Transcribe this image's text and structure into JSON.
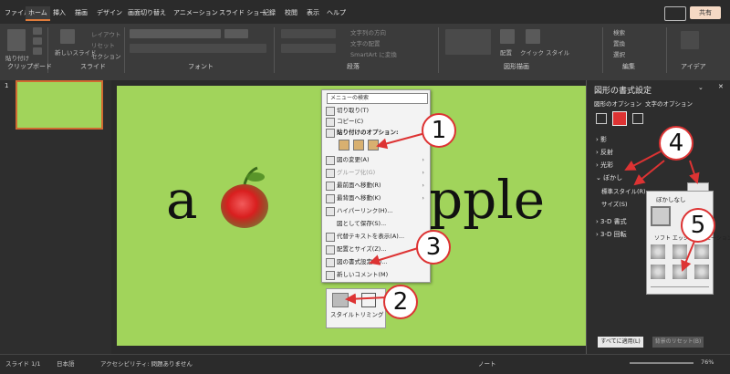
{
  "menubar": {
    "tabs": [
      "ファイル",
      "ホーム",
      "挿入",
      "描画",
      "デザイン",
      "画面切り替え",
      "アニメーション",
      "スライド ショー",
      "記録",
      "校閲",
      "表示",
      "ヘルプ"
    ],
    "share_label": "共有"
  },
  "ribbon": {
    "paste_label": "貼り付け",
    "new_slide_label": "新しいスライド",
    "layout_label": "レイアウト",
    "reset_label": "リセット",
    "section_label": "セクション",
    "text_direction_label": "文字列の方向",
    "align_text_label": "文字の配置",
    "smartart_label": "SmartArt に変換",
    "arrange_label": "配置",
    "quick_style_label": "クイック スタイル",
    "find_label": "検索",
    "replace_label": "置換",
    "select_label": "選択",
    "groups": {
      "clipboard": "クリップボード",
      "slide": "スライド",
      "font": "フォント",
      "paragraph": "段落",
      "drawing": "図形描画",
      "editing": "編集",
      "idea": "アイデア"
    }
  },
  "thumbs": {
    "number": "1"
  },
  "slide": {
    "text_left": "a",
    "text_right": "pple"
  },
  "context_menu": {
    "search": "メニューの検索",
    "items": [
      {
        "label": "切り取り(T)",
        "disabled": false,
        "arrow": ""
      },
      {
        "label": "コピー(C)",
        "disabled": false,
        "arrow": ""
      },
      {
        "label": "貼り付けのオプション:",
        "disabled": false,
        "arrow": ""
      },
      {
        "label": "図の変更(A)",
        "disabled": false,
        "arrow": "›"
      },
      {
        "label": "グループ化(G)",
        "disabled": true,
        "arrow": "›"
      },
      {
        "label": "最前面へ移動(R)",
        "disabled": false,
        "arrow": "›"
      },
      {
        "label": "最背面へ移動(K)",
        "disabled": false,
        "arrow": "›"
      },
      {
        "label": "ハイパーリンク(H)...",
        "disabled": false,
        "arrow": ""
      },
      {
        "label": "図として保存(S)...",
        "disabled": false,
        "arrow": ""
      },
      {
        "label": "代替テキストを表示(A)...",
        "disabled": false,
        "arrow": ""
      },
      {
        "label": "配置とサイズ(Z)...",
        "disabled": false,
        "arrow": ""
      },
      {
        "label": "図の書式設定(O)...",
        "disabled": false,
        "arrow": ""
      },
      {
        "label": "新しいコメント(M)",
        "disabled": false,
        "arrow": ""
      }
    ]
  },
  "minibar": {
    "style_label": "スタイル",
    "crop_label": "トリミング"
  },
  "pane": {
    "title": "図形の書式設定",
    "tab_shape": "図形のオプション",
    "tab_text": "文字のオプション",
    "sections": [
      "影",
      "反射",
      "光彩",
      "ぼかし"
    ],
    "preset_label": "標準スタイル(R)",
    "size_label": "サイズ(S)",
    "sections_after": [
      "3-D 書式",
      "3-D 回転"
    ],
    "apply_all": "すべてに適用(L)",
    "reset": "背景のリセット(B)"
  },
  "blur_popup": {
    "none_label": "ぼかしなし",
    "variation_label": "ソフト エッジのバリエーション"
  },
  "callouts": [
    "1",
    "2",
    "3",
    "4",
    "5"
  ],
  "status": {
    "slide": "スライド 1/1",
    "lang": "日本語",
    "accessibility": "アクセシビリティ: 問題ありません",
    "notes": "ノート",
    "zoom": "76%"
  },
  "colors": {
    "slide_bg": "#a1d45b",
    "accent": "#e07c3b",
    "callout_border": "#dd3333"
  }
}
